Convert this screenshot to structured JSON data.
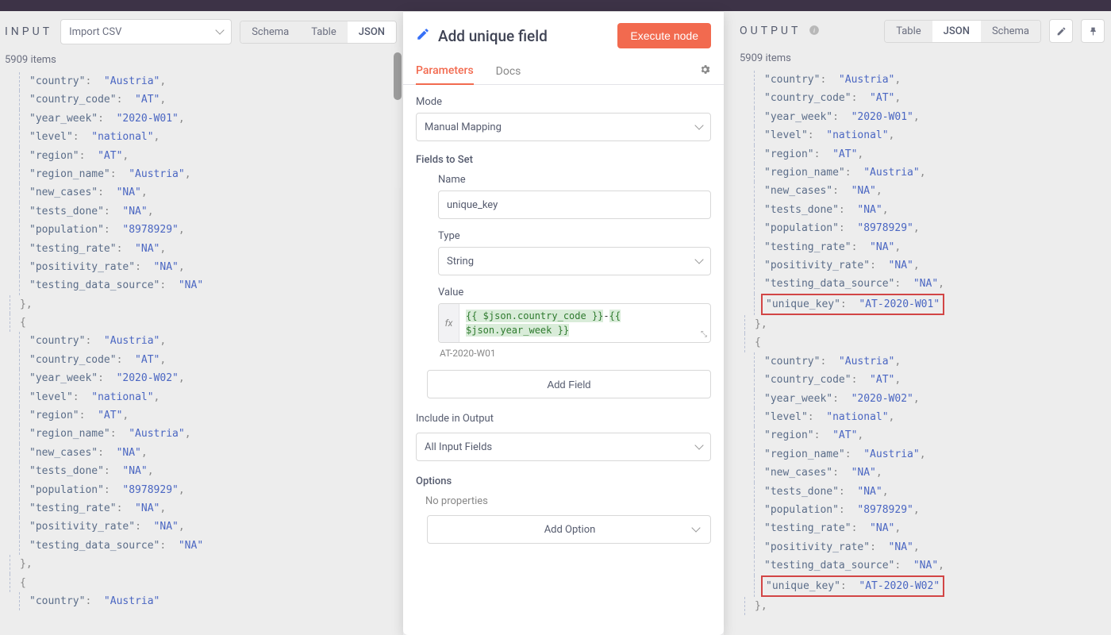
{
  "top_decoration": true,
  "input_panel": {
    "title": "INPUT",
    "selected_node": "Import CSV",
    "item_count": "5909 items",
    "tabs": [
      "Schema",
      "Table",
      "JSON"
    ],
    "active_tab": "JSON",
    "records": [
      {
        "fields": [
          [
            "country",
            "Austria"
          ],
          [
            "country_code",
            "AT"
          ],
          [
            "year_week",
            "2020-W01"
          ],
          [
            "level",
            "national"
          ],
          [
            "region",
            "AT"
          ],
          [
            "region_name",
            "Austria"
          ],
          [
            "new_cases",
            "NA"
          ],
          [
            "tests_done",
            "NA"
          ],
          [
            "population",
            "8978929"
          ],
          [
            "testing_rate",
            "NA"
          ],
          [
            "positivity_rate",
            "NA"
          ],
          [
            "testing_data_source",
            "NA"
          ]
        ]
      },
      {
        "fields": [
          [
            "country",
            "Austria"
          ],
          [
            "country_code",
            "AT"
          ],
          [
            "year_week",
            "2020-W02"
          ],
          [
            "level",
            "national"
          ],
          [
            "region",
            "AT"
          ],
          [
            "region_name",
            "Austria"
          ],
          [
            "new_cases",
            "NA"
          ],
          [
            "tests_done",
            "NA"
          ],
          [
            "population",
            "8978929"
          ],
          [
            "testing_rate",
            "NA"
          ],
          [
            "positivity_rate",
            "NA"
          ],
          [
            "testing_data_source",
            "NA"
          ]
        ]
      },
      {
        "fields": [
          [
            "country",
            "Austria"
          ]
        ]
      }
    ]
  },
  "output_panel": {
    "title": "OUTPUT",
    "item_count": "5909 items",
    "tabs": [
      "Table",
      "JSON",
      "Schema"
    ],
    "active_tab": "JSON",
    "records": [
      {
        "fields": [
          [
            "country",
            "Austria"
          ],
          [
            "country_code",
            "AT"
          ],
          [
            "year_week",
            "2020-W01"
          ],
          [
            "level",
            "national"
          ],
          [
            "region",
            "AT"
          ],
          [
            "region_name",
            "Austria"
          ],
          [
            "new_cases",
            "NA"
          ],
          [
            "tests_done",
            "NA"
          ],
          [
            "population",
            "8978929"
          ],
          [
            "testing_rate",
            "NA"
          ],
          [
            "positivity_rate",
            "NA"
          ],
          [
            "testing_data_source",
            "NA"
          ],
          [
            "unique_key",
            "AT-2020-W01",
            true
          ]
        ]
      },
      {
        "fields": [
          [
            "country",
            "Austria"
          ],
          [
            "country_code",
            "AT"
          ],
          [
            "year_week",
            "2020-W02"
          ],
          [
            "level",
            "national"
          ],
          [
            "region",
            "AT"
          ],
          [
            "region_name",
            "Austria"
          ],
          [
            "new_cases",
            "NA"
          ],
          [
            "tests_done",
            "NA"
          ],
          [
            "population",
            "8978929"
          ],
          [
            "testing_rate",
            "NA"
          ],
          [
            "positivity_rate",
            "NA"
          ],
          [
            "testing_data_source",
            "NA"
          ],
          [
            "unique_key",
            "AT-2020-W02",
            true
          ]
        ]
      }
    ]
  },
  "dialog": {
    "icon": "pencil",
    "title": "Add unique field",
    "execute_label": "Execute node",
    "tabs": [
      "Parameters",
      "Docs"
    ],
    "active_tab": "Parameters",
    "mode_label": "Mode",
    "mode_value": "Manual Mapping",
    "fields_label": "Fields to Set",
    "field_name_label": "Name",
    "field_name_value": "unique_key",
    "field_type_label": "Type",
    "field_type_value": "String",
    "field_value_label": "Value",
    "expr_part1": "{{ $json.country_code }}",
    "expr_sep": "-",
    "expr_part2": "{{ $json.year_week }}",
    "expr_result": "AT-2020-W01",
    "add_field_label": "Add Field",
    "include_label": "Include in Output",
    "include_value": "All Input Fields",
    "options_label": "Options",
    "no_properties": "No properties",
    "add_option_label": "Add Option"
  }
}
